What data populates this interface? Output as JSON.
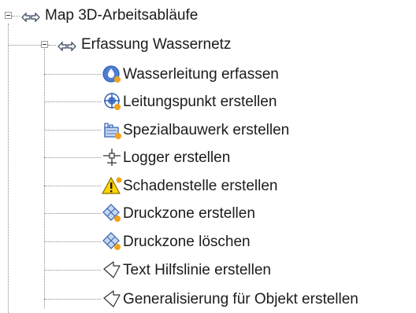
{
  "tree": {
    "root": {
      "label": "Map 3D-Arbeitsabläufe",
      "icon": "workflow-icon",
      "expanded": true
    },
    "group": {
      "label": "Erfassung Wassernetz",
      "icon": "workflow-icon",
      "expanded": true
    },
    "items": [
      {
        "label": "Wasserleitung erfassen",
        "icon": "water-pipe-icon"
      },
      {
        "label": "Leitungspunkt erstellen",
        "icon": "pipe-point-icon"
      },
      {
        "label": "Spezialbauwerk erstellen",
        "icon": "special-structure-icon"
      },
      {
        "label": "Logger erstellen",
        "icon": "logger-icon"
      },
      {
        "label": "Schadenstelle erstellen",
        "icon": "damage-warning-icon"
      },
      {
        "label": "Druckzone erstellen",
        "icon": "pressure-zone-icon"
      },
      {
        "label": "Druckzone löschen",
        "icon": "pressure-zone-delete-icon"
      },
      {
        "label": "Text Hilfslinie erstellen",
        "icon": "text-guideline-icon"
      },
      {
        "label": "Generalisierung für Objekt erstellen",
        "icon": "generalize-object-icon"
      }
    ]
  },
  "colors": {
    "tree_lines": "#8a8a8a",
    "accent_blue": "#2f5fae",
    "accent_orange": "#f2a21a",
    "warning_yellow": "#ffd400"
  }
}
